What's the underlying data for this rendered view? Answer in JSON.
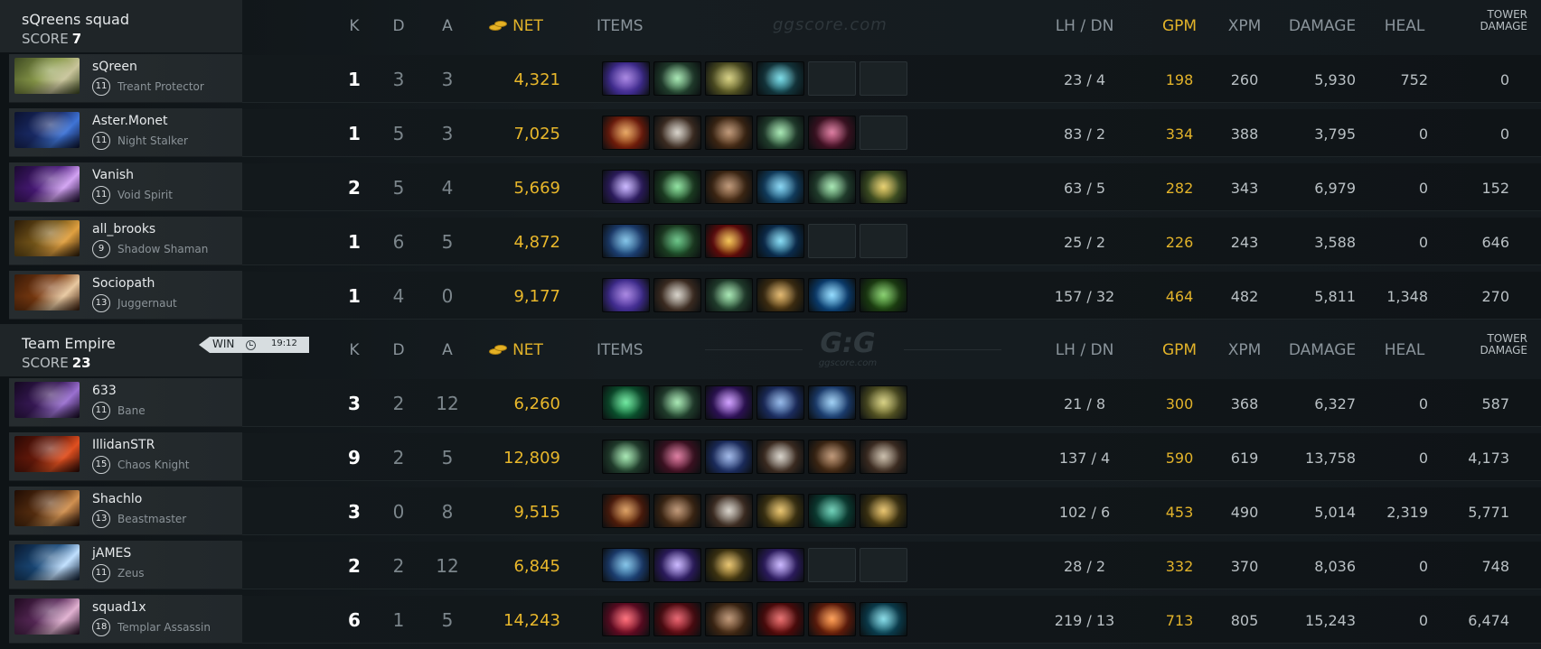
{
  "columns": {
    "k": "K",
    "d": "D",
    "a": "A",
    "net": "NET",
    "items": "ITEMS",
    "lhdn": "LH / DN",
    "gpm": "GPM",
    "xpm": "XPM",
    "damage": "DAMAGE",
    "heal": "HEAL",
    "tower_1": "TOWER",
    "tower_2": "DAMAGE"
  },
  "watermark": {
    "text": "ggscore.com",
    "logo": "G:G",
    "logo_small": "ggscore.com"
  },
  "result": {
    "label": "WIN",
    "time": "19:12",
    "icon": "clock-icon"
  },
  "teams": [
    {
      "name": "sQreens squad",
      "score_label": "SCORE",
      "score": "7",
      "players": [
        {
          "name": "sQreen",
          "level": "11",
          "hero": "Treant Protector",
          "k": "1",
          "d": "3",
          "a": "3",
          "net": "4,321",
          "lhdn": "23 / 4",
          "gpm": "198",
          "xpm": "260",
          "damage": "5,930",
          "heal": "752",
          "tower": "0",
          "portrait": [
            "#8a9a4a",
            "#c8c49a",
            "#3e4a22"
          ],
          "items": [
            [
              "#3d2a8a",
              "#8b5dd8"
            ],
            [
              "#1f3a2a",
              "#8adf9a"
            ],
            [
              "#4a4a20",
              "#c8c05a"
            ],
            [
              "#12333a",
              "#4fd0e0"
            ],
            null,
            null
          ]
        },
        {
          "name": "Aster.Monet",
          "level": "11",
          "hero": "Night Stalker",
          "k": "1",
          "d": "5",
          "a": "3",
          "net": "7,025",
          "lhdn": "83 / 2",
          "gpm": "334",
          "xpm": "388",
          "damage": "3,795",
          "heal": "0",
          "tower": "0",
          "portrait": [
            "#1a2c6a",
            "#3f74d6",
            "#0b1230"
          ],
          "items": [
            [
              "#6a1a0a",
              "#e08a30"
            ],
            [
              "#3a2a20",
              "#c9c3b8"
            ],
            [
              "#3a2412",
              "#a8744a"
            ],
            [
              "#1f3a2a",
              "#8adf9a"
            ],
            [
              "#3a1020",
              "#d05080"
            ],
            null
          ]
        },
        {
          "name": "Vanish",
          "level": "11",
          "hero": "Void Spirit",
          "k": "2",
          "d": "5",
          "a": "4",
          "net": "5,669",
          "lhdn": "63 / 5",
          "gpm": "282",
          "xpm": "343",
          "damage": "6,979",
          "heal": "0",
          "tower": "152",
          "portrait": [
            "#4a1a7a",
            "#d2a2f2",
            "#1a0a30"
          ],
          "items": [
            [
              "#2a1a5a",
              "#b9a0ff"
            ],
            [
              "#1a3a20",
              "#6ad880"
            ],
            [
              "#3a2412",
              "#a8744a"
            ],
            [
              "#103a5a",
              "#60c8f0"
            ],
            [
              "#1f3a2a",
              "#8adf9a"
            ],
            [
              "#3a4a20",
              "#e0c040"
            ]
          ]
        },
        {
          "name": "all_brooks",
          "level": "9",
          "hero": "Shadow Shaman",
          "k": "1",
          "d": "6",
          "a": "5",
          "net": "4,872",
          "lhdn": "25 / 2",
          "gpm": "226",
          "xpm": "243",
          "damage": "3,588",
          "heal": "0",
          "tower": "646",
          "portrait": [
            "#7a5a1a",
            "#e0a040",
            "#2a1a08"
          ],
          "items": [
            [
              "#1a3a6a",
              "#5ab0e0"
            ],
            [
              "#1a3a20",
              "#3ab060"
            ],
            [
              "#5a0a0a",
              "#f0b020"
            ],
            [
              "#0a2a4a",
              "#60d0f0"
            ],
            null,
            null
          ]
        },
        {
          "name": "Sociopath",
          "level": "13",
          "hero": "Juggernaut",
          "k": "1",
          "d": "4",
          "a": "0",
          "net": "9,177",
          "lhdn": "157 / 32",
          "gpm": "464",
          "xpm": "482",
          "damage": "5,811",
          "heal": "1,348",
          "tower": "270",
          "portrait": [
            "#7a3a10",
            "#e8c8a0",
            "#3a1a08"
          ],
          "items": [
            [
              "#3d2a8a",
              "#8b5dd8"
            ],
            [
              "#3a2a20",
              "#c9c3b8"
            ],
            [
              "#1f3a2a",
              "#8adf9a"
            ],
            [
              "#3a2a10",
              "#d8a040"
            ],
            [
              "#0a3a6a",
              "#70d0ff"
            ],
            [
              "#1a3a10",
              "#60c040"
            ]
          ]
        }
      ]
    },
    {
      "name": "Team Empire",
      "score_label": "SCORE",
      "score": "23",
      "players": [
        {
          "name": "633",
          "level": "11",
          "hero": "Bane",
          "k": "3",
          "d": "2",
          "a": "12",
          "net": "6,260",
          "lhdn": "21 / 8",
          "gpm": "300",
          "xpm": "368",
          "damage": "6,327",
          "heal": "0",
          "tower": "587",
          "portrait": [
            "#3a1a5a",
            "#9a70d0",
            "#140820"
          ],
          "items": [
            [
              "#0a4a2a",
              "#40e080"
            ],
            [
              "#1f3a2a",
              "#8adf9a"
            ],
            [
              "#2a1050",
              "#c080ff"
            ],
            [
              "#1a2a5a",
              "#70a0e0"
            ],
            [
              "#1a3a6a",
              "#80c0f0"
            ],
            [
              "#4a4a20",
              "#c8c05a"
            ]
          ]
        },
        {
          "name": "IllidanSTR",
          "level": "15",
          "hero": "Chaos Knight",
          "k": "9",
          "d": "2",
          "a": "5",
          "net": "12,809",
          "lhdn": "137 / 4",
          "gpm": "590",
          "xpm": "619",
          "damage": "13,758",
          "heal": "0",
          "tower": "4,173",
          "portrait": [
            "#6a1a0a",
            "#e05020",
            "#2a0804"
          ],
          "items": [
            [
              "#1f3a2a",
              "#8adf9a"
            ],
            [
              "#3a1020",
              "#d05080"
            ],
            [
              "#1a2a5a",
              "#80a0e0"
            ],
            [
              "#3a2a20",
              "#c9c3b8"
            ],
            [
              "#3a2412",
              "#a8744a"
            ],
            [
              "#3a2a20",
              "#b8a890"
            ]
          ]
        },
        {
          "name": "Shachlo",
          "level": "13",
          "hero": "Beastmaster",
          "k": "3",
          "d": "0",
          "a": "8",
          "net": "9,515",
          "lhdn": "102 / 6",
          "gpm": "453",
          "xpm": "490",
          "damage": "5,014",
          "heal": "2,319",
          "tower": "5,771",
          "portrait": [
            "#5a3010",
            "#d09050",
            "#200c04"
          ],
          "items": [
            [
              "#4a1a0a",
              "#d08030"
            ],
            [
              "#3a2412",
              "#a8744a"
            ],
            [
              "#3a2a20",
              "#c9c3b8"
            ],
            [
              "#3a3010",
              "#e0b040"
            ],
            [
              "#0a3a30",
              "#40c0a0"
            ],
            [
              "#3a3010",
              "#e0b040"
            ]
          ]
        },
        {
          "name": "jAMES",
          "level": "11",
          "hero": "Zeus",
          "k": "2",
          "d": "2",
          "a": "12",
          "net": "6,845",
          "lhdn": "28 / 2",
          "gpm": "332",
          "xpm": "370",
          "damage": "8,036",
          "heal": "0",
          "tower": "748",
          "portrait": [
            "#1a4a7a",
            "#c0e0ff",
            "#0a1a30"
          ],
          "items": [
            [
              "#1a3a6a",
              "#5ab0e0"
            ],
            [
              "#2a1a5a",
              "#b9a0ff"
            ],
            [
              "#3a3010",
              "#e0b040"
            ],
            [
              "#2a1a5a",
              "#b9a0ff"
            ],
            null,
            null
          ]
        },
        {
          "name": "squad1x",
          "level": "18",
          "hero": "Templar Assassin",
          "k": "6",
          "d": "1",
          "a": "5",
          "net": "14,243",
          "lhdn": "219 / 13",
          "gpm": "713",
          "xpm": "805",
          "damage": "15,243",
          "heal": "0",
          "tower": "6,474",
          "portrait": [
            "#5a2a5a",
            "#e0b0d0",
            "#200a20"
          ],
          "items": [
            [
              "#5a0a20",
              "#ff4050"
            ],
            [
              "#4a0a10",
              "#e03040"
            ],
            [
              "#3a2412",
              "#a8744a"
            ],
            [
              "#4a0a0a",
              "#e04040"
            ],
            [
              "#5a1a0a",
              "#ff8020"
            ],
            [
              "#0a3a4a",
              "#60d0e0"
            ]
          ]
        }
      ]
    }
  ]
}
